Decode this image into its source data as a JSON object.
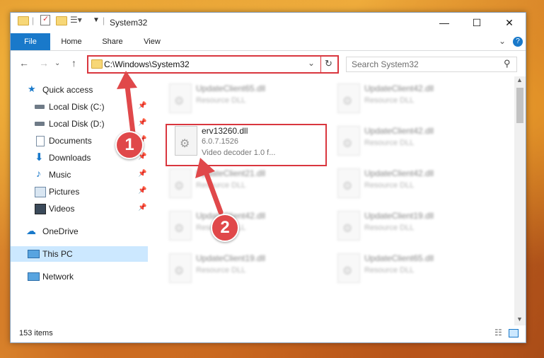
{
  "window": {
    "title": "System32",
    "controls": {
      "minimize": "—",
      "maximize": "☐",
      "close": "✕"
    }
  },
  "ribbon": {
    "tabs": [
      "File",
      "Home",
      "Share",
      "View"
    ],
    "expand_icon": "⌄",
    "help_icon": "?"
  },
  "address": {
    "path": "C:\\Windows\\System32",
    "dropdown_icon": "⌄",
    "refresh_icon": "↻"
  },
  "search": {
    "placeholder": "Search System32",
    "icon": "⚲"
  },
  "nav": {
    "back": "←",
    "forward": "→",
    "recent": "⌄",
    "up": "↑"
  },
  "sidebar": {
    "items": [
      {
        "label": "Quick access"
      },
      {
        "label": "Local Disk (C:)"
      },
      {
        "label": "Local Disk (D:)"
      },
      {
        "label": "Documents"
      },
      {
        "label": "Downloads"
      },
      {
        "label": "Music"
      },
      {
        "label": "Pictures"
      },
      {
        "label": "Videos"
      },
      {
        "label": "OneDrive"
      },
      {
        "label": "This PC"
      },
      {
        "label": "Network"
      }
    ]
  },
  "files": {
    "highlighted": {
      "name": "erv13260.dll",
      "version": "6.0.7.1526",
      "description": "Video decoder 1.0 f..."
    },
    "tiles": [
      {
        "name": "UpdateClient65.dll",
        "desc": "Resource DLL"
      },
      {
        "name": "UpdateClient42.dll",
        "desc": "Resource DLL"
      },
      {
        "name": "UpdateClient42.dll",
        "desc": "Resource DLL"
      },
      {
        "name": "UpdateClient21.dll",
        "desc": "Resource DLL"
      },
      {
        "name": "UpdateClient42.dll",
        "desc": "Resource DLL"
      },
      {
        "name": "UpdateClient42.dll",
        "desc": "Resource DLL"
      },
      {
        "name": "UpdateClient19.dll",
        "desc": "Resource DLL"
      },
      {
        "name": "UpdateClient19.dll",
        "desc": "Resource DLL"
      },
      {
        "name": "UpdateClient65.dll",
        "desc": "Resource DLL"
      }
    ]
  },
  "status": {
    "item_count": "153 items"
  },
  "annotations": {
    "step1": "1",
    "step2": "2",
    "color": "#e0484a"
  }
}
